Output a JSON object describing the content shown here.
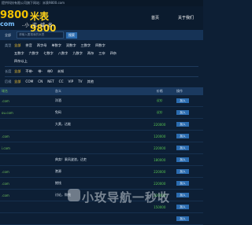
{
  "topbar": {
    "text": "提供科技有限公司旗下网站：米表9800.com"
  },
  "brand": {
    "logo_num": "9800",
    "logo_cn": "米表9800",
    "logo_sub": "-小·志·域·名-",
    "logo_com": "com"
  },
  "nav": {
    "items": [
      "首页",
      "关于我们"
    ]
  },
  "search": {
    "select_label": "全部",
    "placeholder": "请输入要搜索的米表",
    "button": "搜索"
  },
  "filters": {
    "rows": [
      {
        "label": "类型",
        "options": [
          "全部",
          "拼音",
          "两字母",
          "单数字",
          "双数字",
          "三数字",
          "四数字"
        ]
      },
      {
        "label": "",
        "options": [
          "五数字",
          "六数字",
          "七数字",
          "八数字",
          "九数字",
          "两杂",
          "三杂",
          "四杂"
        ]
      },
      {
        "label": "",
        "options": [
          "四杂以上"
        ]
      },
      {
        "label": "长度",
        "options": [
          "全部",
          "不带-",
          "带-",
          "带0",
          "未知"
        ]
      },
      {
        "label": "后缀",
        "options": [
          "全部",
          "COM",
          "CN",
          "NET",
          "CC",
          "VIP",
          "TV",
          "其他"
        ]
      }
    ]
  },
  "table": {
    "headers": [
      "域名",
      "含义",
      "价格",
      "操作"
    ],
    "rows": [
      {
        "domain": ".com",
        "meaning": "洋酒",
        "price": "议价",
        "action": "加入"
      },
      {
        "domain": "ou.com",
        "meaning": "免码",
        "price": "议价",
        "action": "加入"
      },
      {
        "domain": "",
        "meaning": "大黄，达能",
        "price": "220000",
        "action": "加入"
      },
      {
        "domain": ".com",
        "meaning": "",
        "price": "120000",
        "action": "加入"
      },
      {
        "domain": "i.com",
        "meaning": "",
        "price": "220000",
        "action": "加入"
      },
      {
        "domain": "",
        "meaning": "典卖！乘风波浪，达吏",
        "price": "180000",
        "action": "加入"
      },
      {
        "domain": ".com",
        "meaning": "港源",
        "price": "220000",
        "action": "加入"
      },
      {
        "domain": ".com",
        "meaning": "猪钱",
        "price": "220000",
        "action": "加入"
      },
      {
        "domain": ".com",
        "meaning": "讨论，购钱",
        "price": "220000",
        "action": "加入"
      },
      {
        "domain": "",
        "meaning": "",
        "price": "150000",
        "action": "加入"
      },
      {
        "domain": "",
        "meaning": "",
        "price": "",
        "action": "加入"
      }
    ]
  },
  "watermark": {
    "text": "小玫导航一秒收"
  }
}
